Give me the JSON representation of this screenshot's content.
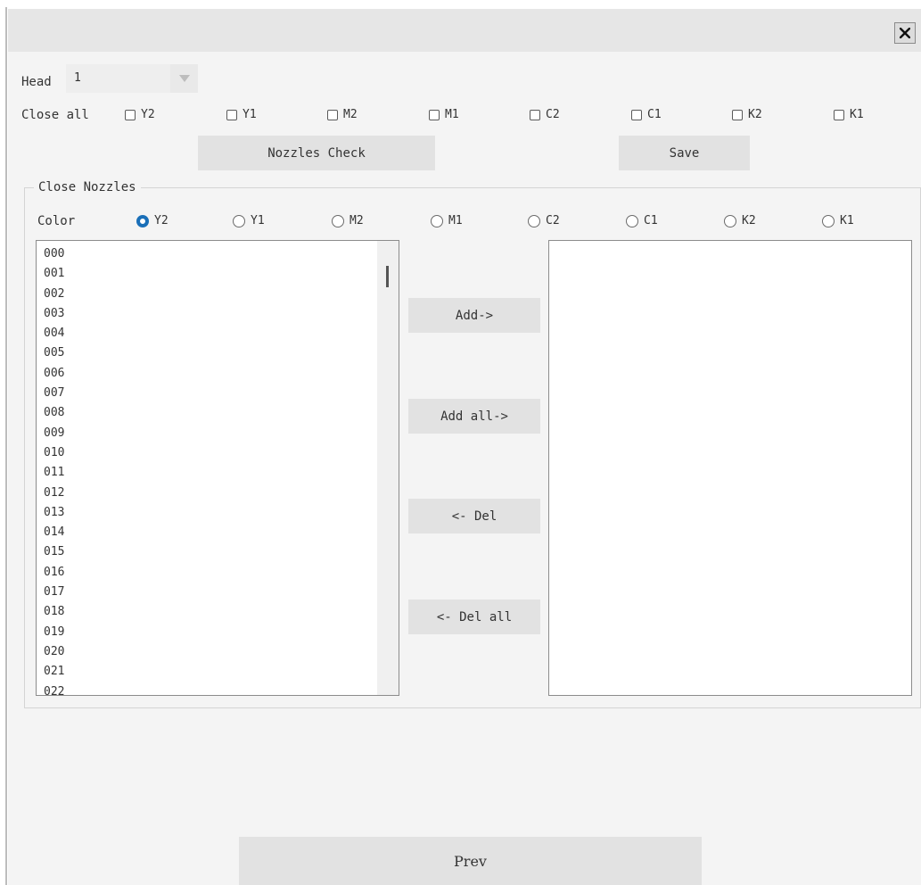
{
  "dialog": {
    "close_icon": "close-icon"
  },
  "head": {
    "label": "Head",
    "value": "1"
  },
  "close_all": {
    "label": "Close all",
    "colors": [
      "Y2",
      "Y1",
      "M2",
      "M1",
      "C2",
      "C1",
      "K2",
      "K1"
    ]
  },
  "buttons": {
    "nozzles_check": "Nozzles Check",
    "save": "Save",
    "add": "Add->",
    "add_all": "Add all->",
    "del": "<- Del",
    "del_all": "<- Del all",
    "prev": "Prev"
  },
  "close_nozzles": {
    "title": "Close Nozzles",
    "color_label": "Color",
    "colors": [
      "Y2",
      "Y1",
      "M2",
      "M1",
      "C2",
      "C1",
      "K2",
      "K1"
    ],
    "selected": "Y2",
    "accent_color": "#1a6fb8",
    "available": [
      "000",
      "001",
      "002",
      "003",
      "004",
      "005",
      "006",
      "007",
      "008",
      "009",
      "010",
      "011",
      "012",
      "013",
      "014",
      "015",
      "016",
      "017",
      "018",
      "019",
      "020",
      "021",
      "022"
    ],
    "closed": []
  }
}
